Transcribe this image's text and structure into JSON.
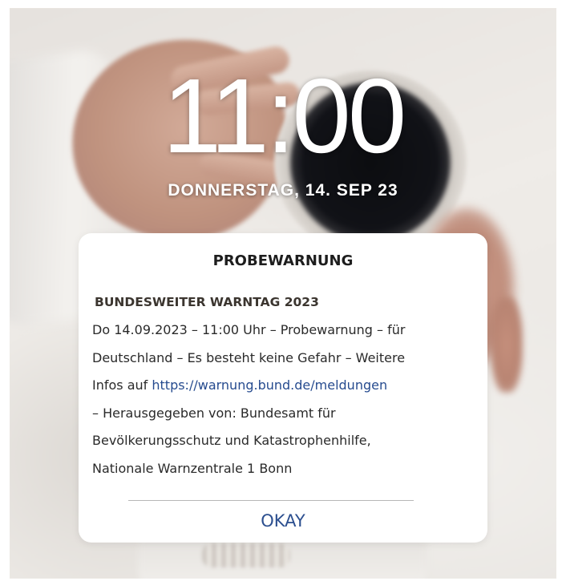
{
  "lock_screen": {
    "time": "11:00",
    "date": "DONNERSTAG, 14. SEP 23"
  },
  "alert": {
    "title": "PROBEWARNUNG",
    "subtitle": "BUNDESWEITER WARNTAG 2023",
    "body_lines": [
      "Do 14.09.2023 – 11:00 Uhr – Probewarnung – für",
      "Deutschland – Es besteht keine Gefahr – Weitere",
      "Infos auf ",
      " – Herausgegeben von: Bundesamt für",
      "Bevölkerungsschutz und Katastrophenhilfe,",
      "Nationale Warnzentrale 1 Bonn"
    ],
    "link_text": "https://warnung.bund.de/meldungen",
    "ok_label": "OKAY"
  },
  "colors": {
    "link": "#264b8f",
    "button": "#2c4f8f",
    "dialog_background": "#ffffff"
  }
}
